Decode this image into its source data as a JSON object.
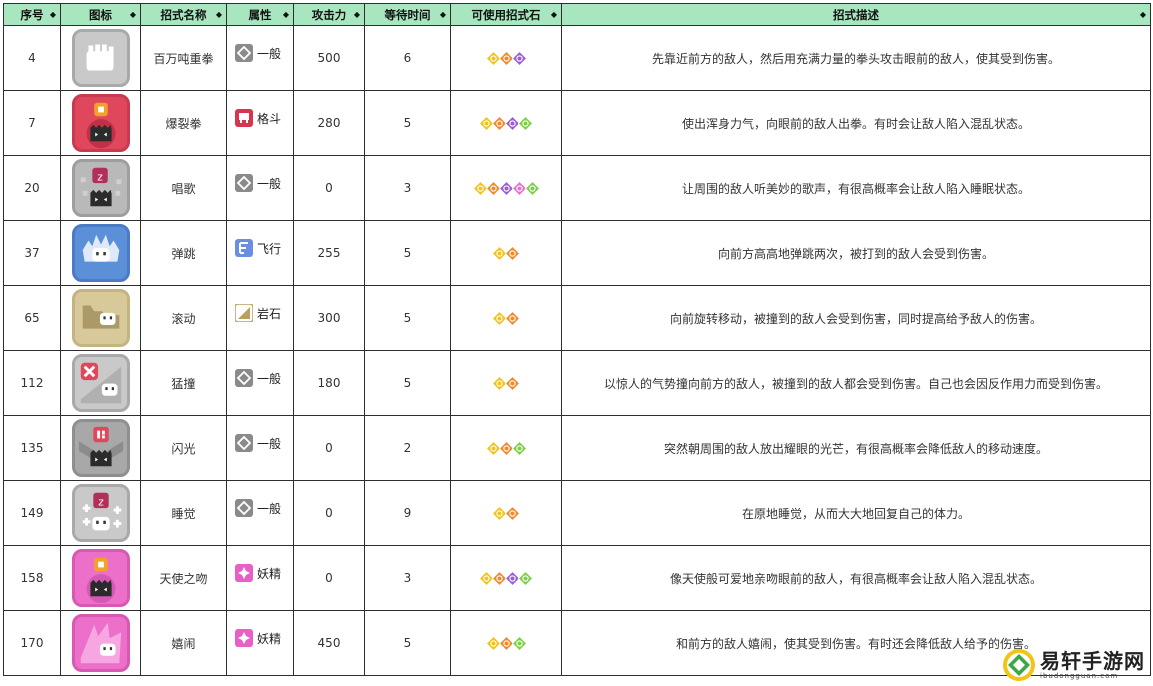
{
  "headers": [
    "序号",
    "图标",
    "招式名称",
    "属性",
    "攻击力",
    "等待时间",
    "可使用招式石",
    "招式描述"
  ],
  "sort_icon": "sort-arrows-icon",
  "rows": [
    {
      "no": "4",
      "name": "百万吨重拳",
      "attr": "一般",
      "attr_type": "normal",
      "attack": "500",
      "wait": "6",
      "stones": [
        "yellow",
        "orange",
        "purple"
      ],
      "desc": "先靠近前方的敌人，然后用充满力量的拳头攻击眼前的敌人，使其受到伤害。",
      "icon": {
        "bg": "#c9c9c9",
        "border": "#a9a9a9",
        "art": "fist"
      }
    },
    {
      "no": "7",
      "name": "爆裂拳",
      "attr": "格斗",
      "attr_type": "fighting",
      "attack": "280",
      "wait": "5",
      "stones": [
        "yellow",
        "orange",
        "purple",
        "green"
      ],
      "desc": "使出浑身力气，向眼前的敌人出拳。有时会让敌人陷入混乱状态。",
      "icon": {
        "bg": "#e0475c",
        "border": "#c73a50",
        "art": "confuse-burst"
      }
    },
    {
      "no": "20",
      "name": "唱歌",
      "attr": "一般",
      "attr_type": "normal",
      "attack": "0",
      "wait": "3",
      "stones": [
        "yellow",
        "orange",
        "purple",
        "pink",
        "green"
      ],
      "desc": "让周围的敌人听美妙的歌声，有很高概率会让敌人陷入睡眠状态。",
      "icon": {
        "bg": "#b9b9b9",
        "border": "#9e9e9e",
        "art": "sleep-dots"
      }
    },
    {
      "no": "37",
      "name": "弹跳",
      "attr": "飞行",
      "attr_type": "flying",
      "attack": "255",
      "wait": "5",
      "stones": [
        "yellow",
        "orange"
      ],
      "desc": "向前方高高地弹跳两次，被打到的敌人会受到伤害。",
      "icon": {
        "bg": "#5b8fd8",
        "border": "#4a7bc4",
        "art": "bounce"
      }
    },
    {
      "no": "65",
      "name": "滚动",
      "attr": "岩石",
      "attr_type": "rock",
      "attack": "300",
      "wait": "5",
      "stones": [
        "yellow",
        "orange"
      ],
      "desc": "向前旋转移动，被撞到的敌人会受到伤害，同时提高给予敌人的伤害。",
      "icon": {
        "bg": "#d7c99a",
        "border": "#c4b47f",
        "art": "roll"
      }
    },
    {
      "no": "112",
      "name": "猛撞",
      "attr": "一般",
      "attr_type": "normal",
      "attack": "180",
      "wait": "5",
      "stones": [
        "yellow",
        "orange"
      ],
      "desc": "以惊人的气势撞向前方的敌人，被撞到的敌人都会受到伤害。自己也会因反作用力而受到伤害。",
      "icon": {
        "bg": "#c9c9c9",
        "border": "#a9a9a9",
        "art": "tackle"
      }
    },
    {
      "no": "135",
      "name": "闪光",
      "attr": "一般",
      "attr_type": "normal",
      "attack": "0",
      "wait": "2",
      "stones": [
        "yellow",
        "orange",
        "green"
      ],
      "desc": "突然朝周围的敌人放出耀眼的光芒，有很高概率会降低敌人的移动速度。",
      "icon": {
        "bg": "#a8a8a8",
        "border": "#8f8f8f",
        "art": "flash"
      }
    },
    {
      "no": "149",
      "name": "睡觉",
      "attr": "一般",
      "attr_type": "normal",
      "attack": "0",
      "wait": "9",
      "stones": [
        "yellow",
        "orange"
      ],
      "desc": "在原地睡觉，从而大大地回复自己的体力。",
      "icon": {
        "bg": "#c9c9c9",
        "border": "#a9a9a9",
        "art": "rest"
      }
    },
    {
      "no": "158",
      "name": "天使之吻",
      "attr": "妖精",
      "attr_type": "fairy",
      "attack": "0",
      "wait": "3",
      "stones": [
        "yellow",
        "orange",
        "purple",
        "green"
      ],
      "desc": "像天使般可爱地亲吻眼前的敌人，有很高概率会让敌人陷入混乱状态。",
      "icon": {
        "bg": "#ec6fc9",
        "border": "#d759b3",
        "art": "kiss"
      }
    },
    {
      "no": "170",
      "name": "嬉闹",
      "attr": "妖精",
      "attr_type": "fairy",
      "attack": "450",
      "wait": "5",
      "stones": [
        "yellow",
        "orange",
        "green"
      ],
      "desc": "和前方的敌人嬉闹，使其受到伤害。有时还会降低敌人给予的伤害。",
      "icon": {
        "bg": "#ec6fc9",
        "border": "#d759b3",
        "art": "play-rough"
      }
    }
  ],
  "attr_colors": {
    "normal": "#8a8a8a",
    "fighting": "#d8344f",
    "flying": "#6b8fe0",
    "rock": "#b9a25d",
    "fairy": "#e860c6"
  },
  "stone_colors": {
    "yellow": "#f2c318",
    "orange": "#f08a2c",
    "purple": "#9a5fd6",
    "pink": "#ea6fd0",
    "green": "#7dcf43"
  },
  "logo": {
    "main": "易轩手游网",
    "sub": "ibudongguan.com",
    "icon": "logo-mark-icon"
  }
}
